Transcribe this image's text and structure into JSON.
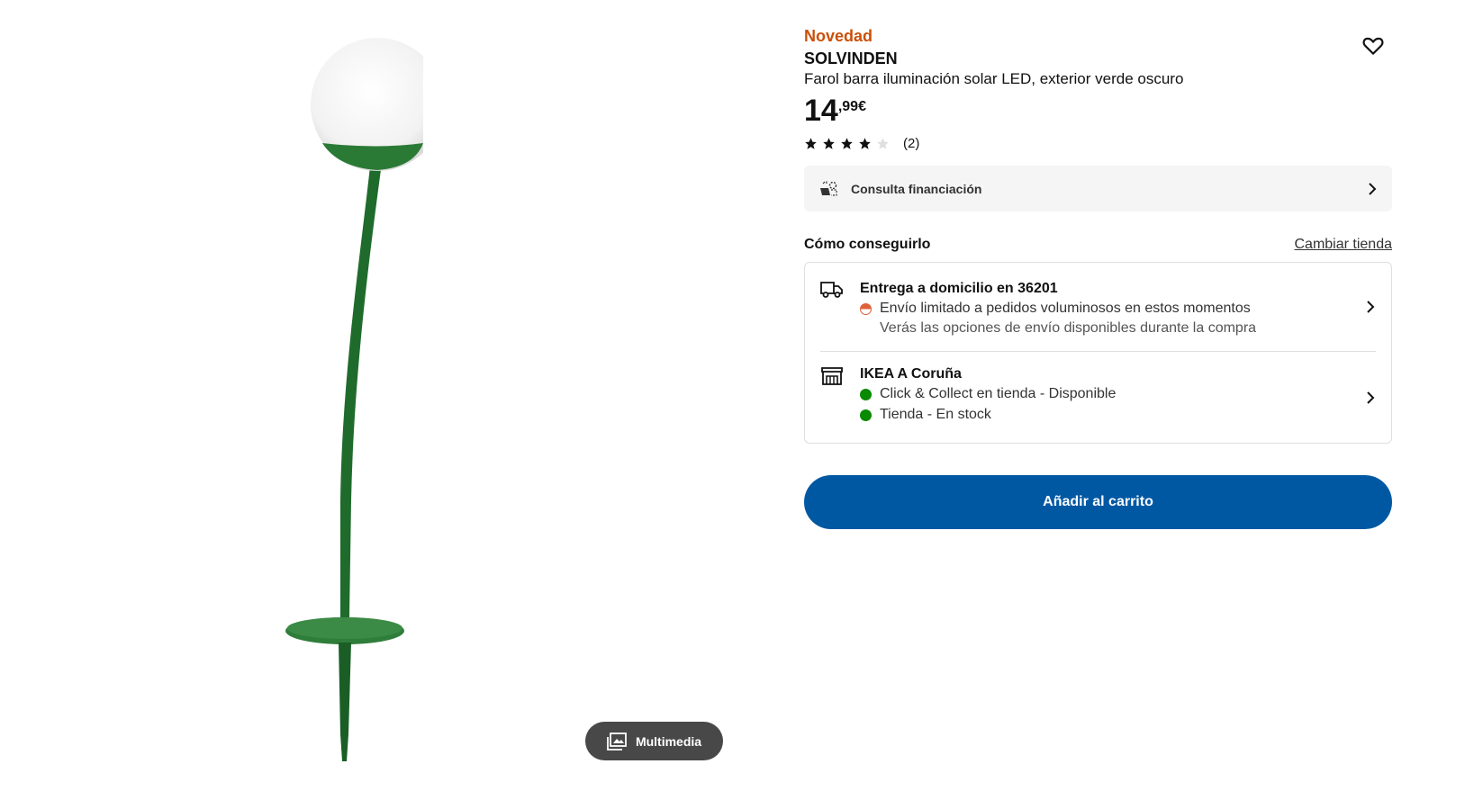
{
  "product": {
    "badge": "Novedad",
    "name": "SOLVINDEN",
    "description": "Farol barra iluminación solar LED, exterior verde oscuro",
    "price_integer": "14",
    "price_decimal": ",99€",
    "rating_value": 4,
    "rating_max": 5,
    "rating_count": "(2)",
    "colors": {
      "badge": "#ca5008",
      "cart": "#0058a3",
      "stem": "#1f6b2c"
    }
  },
  "financing": {
    "label": "Consulta financiación"
  },
  "availability": {
    "title": "Cómo conseguirlo",
    "change_store": "Cambiar tienda",
    "delivery": {
      "title": "Entrega a domicilio en 36201",
      "status": "Envío limitado a pedidos voluminosos en estos momentos",
      "note": "Verás las opciones de envío disponibles durante la compra"
    },
    "store": {
      "title": "IKEA A Coruña",
      "click_collect": "Click & Collect en tienda - Disponible",
      "stock": "Tienda - En stock"
    }
  },
  "cart": {
    "label": "Añadir al carrito"
  },
  "media": {
    "label": "Multimedia"
  }
}
